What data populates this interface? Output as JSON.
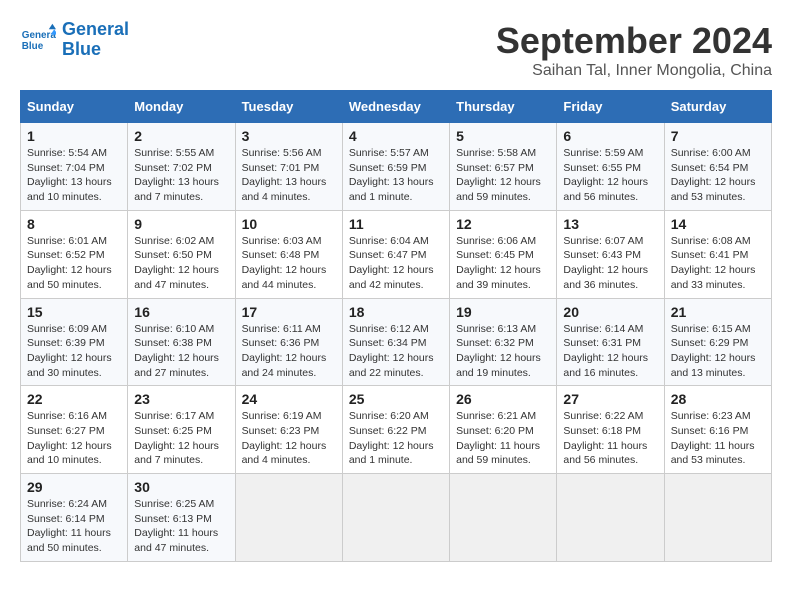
{
  "header": {
    "logo_line1": "General",
    "logo_line2": "Blue",
    "month": "September 2024",
    "location": "Saihan Tal, Inner Mongolia, China"
  },
  "weekdays": [
    "Sunday",
    "Monday",
    "Tuesday",
    "Wednesday",
    "Thursday",
    "Friday",
    "Saturday"
  ],
  "weeks": [
    [
      {
        "day": "1",
        "info": "Sunrise: 5:54 AM\nSunset: 7:04 PM\nDaylight: 13 hours\nand 10 minutes."
      },
      {
        "day": "2",
        "info": "Sunrise: 5:55 AM\nSunset: 7:02 PM\nDaylight: 13 hours\nand 7 minutes."
      },
      {
        "day": "3",
        "info": "Sunrise: 5:56 AM\nSunset: 7:01 PM\nDaylight: 13 hours\nand 4 minutes."
      },
      {
        "day": "4",
        "info": "Sunrise: 5:57 AM\nSunset: 6:59 PM\nDaylight: 13 hours\nand 1 minute."
      },
      {
        "day": "5",
        "info": "Sunrise: 5:58 AM\nSunset: 6:57 PM\nDaylight: 12 hours\nand 59 minutes."
      },
      {
        "day": "6",
        "info": "Sunrise: 5:59 AM\nSunset: 6:55 PM\nDaylight: 12 hours\nand 56 minutes."
      },
      {
        "day": "7",
        "info": "Sunrise: 6:00 AM\nSunset: 6:54 PM\nDaylight: 12 hours\nand 53 minutes."
      }
    ],
    [
      {
        "day": "8",
        "info": "Sunrise: 6:01 AM\nSunset: 6:52 PM\nDaylight: 12 hours\nand 50 minutes."
      },
      {
        "day": "9",
        "info": "Sunrise: 6:02 AM\nSunset: 6:50 PM\nDaylight: 12 hours\nand 47 minutes."
      },
      {
        "day": "10",
        "info": "Sunrise: 6:03 AM\nSunset: 6:48 PM\nDaylight: 12 hours\nand 44 minutes."
      },
      {
        "day": "11",
        "info": "Sunrise: 6:04 AM\nSunset: 6:47 PM\nDaylight: 12 hours\nand 42 minutes."
      },
      {
        "day": "12",
        "info": "Sunrise: 6:06 AM\nSunset: 6:45 PM\nDaylight: 12 hours\nand 39 minutes."
      },
      {
        "day": "13",
        "info": "Sunrise: 6:07 AM\nSunset: 6:43 PM\nDaylight: 12 hours\nand 36 minutes."
      },
      {
        "day": "14",
        "info": "Sunrise: 6:08 AM\nSunset: 6:41 PM\nDaylight: 12 hours\nand 33 minutes."
      }
    ],
    [
      {
        "day": "15",
        "info": "Sunrise: 6:09 AM\nSunset: 6:39 PM\nDaylight: 12 hours\nand 30 minutes."
      },
      {
        "day": "16",
        "info": "Sunrise: 6:10 AM\nSunset: 6:38 PM\nDaylight: 12 hours\nand 27 minutes."
      },
      {
        "day": "17",
        "info": "Sunrise: 6:11 AM\nSunset: 6:36 PM\nDaylight: 12 hours\nand 24 minutes."
      },
      {
        "day": "18",
        "info": "Sunrise: 6:12 AM\nSunset: 6:34 PM\nDaylight: 12 hours\nand 22 minutes."
      },
      {
        "day": "19",
        "info": "Sunrise: 6:13 AM\nSunset: 6:32 PM\nDaylight: 12 hours\nand 19 minutes."
      },
      {
        "day": "20",
        "info": "Sunrise: 6:14 AM\nSunset: 6:31 PM\nDaylight: 12 hours\nand 16 minutes."
      },
      {
        "day": "21",
        "info": "Sunrise: 6:15 AM\nSunset: 6:29 PM\nDaylight: 12 hours\nand 13 minutes."
      }
    ],
    [
      {
        "day": "22",
        "info": "Sunrise: 6:16 AM\nSunset: 6:27 PM\nDaylight: 12 hours\nand 10 minutes."
      },
      {
        "day": "23",
        "info": "Sunrise: 6:17 AM\nSunset: 6:25 PM\nDaylight: 12 hours\nand 7 minutes."
      },
      {
        "day": "24",
        "info": "Sunrise: 6:19 AM\nSunset: 6:23 PM\nDaylight: 12 hours\nand 4 minutes."
      },
      {
        "day": "25",
        "info": "Sunrise: 6:20 AM\nSunset: 6:22 PM\nDaylight: 12 hours\nand 1 minute."
      },
      {
        "day": "26",
        "info": "Sunrise: 6:21 AM\nSunset: 6:20 PM\nDaylight: 11 hours\nand 59 minutes."
      },
      {
        "day": "27",
        "info": "Sunrise: 6:22 AM\nSunset: 6:18 PM\nDaylight: 11 hours\nand 56 minutes."
      },
      {
        "day": "28",
        "info": "Sunrise: 6:23 AM\nSunset: 6:16 PM\nDaylight: 11 hours\nand 53 minutes."
      }
    ],
    [
      {
        "day": "29",
        "info": "Sunrise: 6:24 AM\nSunset: 6:14 PM\nDaylight: 11 hours\nand 50 minutes."
      },
      {
        "day": "30",
        "info": "Sunrise: 6:25 AM\nSunset: 6:13 PM\nDaylight: 11 hours\nand 47 minutes."
      },
      {
        "day": "",
        "info": ""
      },
      {
        "day": "",
        "info": ""
      },
      {
        "day": "",
        "info": ""
      },
      {
        "day": "",
        "info": ""
      },
      {
        "day": "",
        "info": ""
      }
    ]
  ]
}
